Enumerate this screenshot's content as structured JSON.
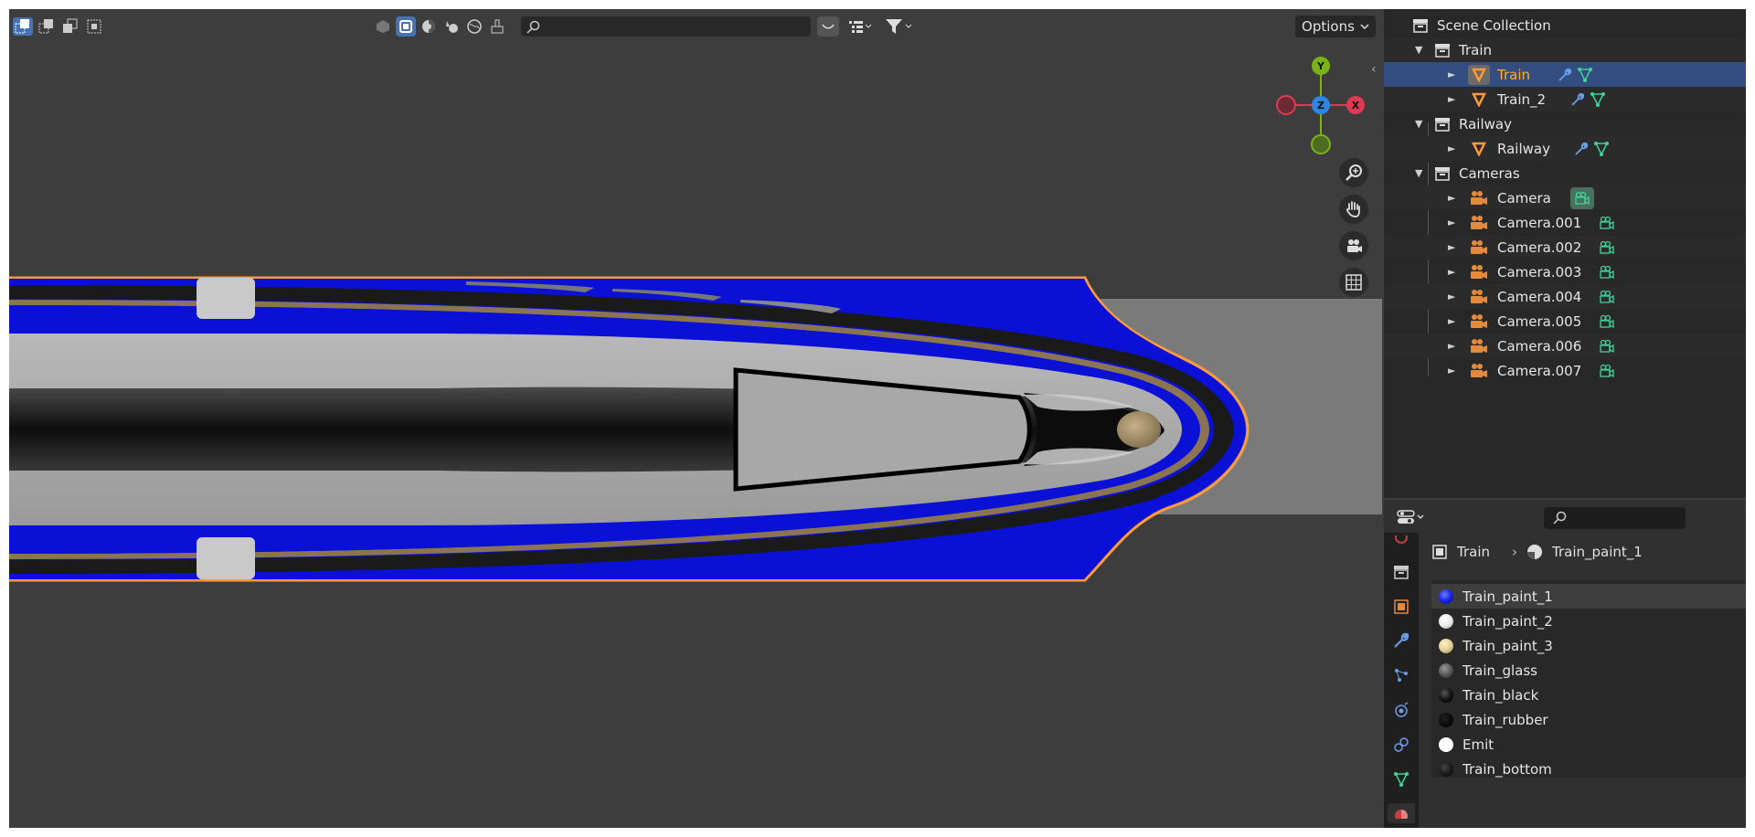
{
  "viewport": {
    "search_placeholder": "",
    "options_label": "Options",
    "gizmo": {
      "y_label": "Y",
      "x_label": "X",
      "z_label": "Z"
    },
    "colors": {
      "train_blue": "#0a10d6",
      "selection_outline": "#ff9a3c",
      "background": "#3d3d3d",
      "ground": "#7a7a7a"
    }
  },
  "outliner": {
    "items": [
      {
        "label": "Scene Collection",
        "type": "scene"
      },
      {
        "label": "Train",
        "type": "collection"
      },
      {
        "label": "Train",
        "type": "mesh",
        "active": true
      },
      {
        "label": "Train_2",
        "type": "mesh"
      },
      {
        "label": "Railway",
        "type": "collection"
      },
      {
        "label": "Railway",
        "type": "mesh"
      },
      {
        "label": "Cameras",
        "type": "collection"
      },
      {
        "label": "Camera",
        "type": "camera"
      },
      {
        "label": "Camera.001",
        "type": "camera"
      },
      {
        "label": "Camera.002",
        "type": "camera"
      },
      {
        "label": "Camera.003",
        "type": "camera"
      },
      {
        "label": "Camera.004",
        "type": "camera"
      },
      {
        "label": "Camera.005",
        "type": "camera"
      },
      {
        "label": "Camera.006",
        "type": "camera"
      },
      {
        "label": "Camera.007",
        "type": "camera"
      }
    ]
  },
  "properties": {
    "search_placeholder": "",
    "breadcrumb": {
      "object": "Train",
      "material": "Train_paint_1"
    },
    "materials": [
      {
        "label": "Train_paint_1",
        "color": "#1020e0"
      },
      {
        "label": "Train_paint_2",
        "color": "#e8e8e8"
      },
      {
        "label": "Train_paint_3",
        "color": "#e0c890"
      },
      {
        "label": "Train_glass",
        "color": "#555555"
      },
      {
        "label": "Train_black",
        "color": "#111111"
      },
      {
        "label": "Train_rubber",
        "color": "#0a0a0a"
      },
      {
        "label": "Emit",
        "color": "#ffffff"
      },
      {
        "label": "Train_bottom",
        "color": "#1a1a1a"
      }
    ]
  }
}
